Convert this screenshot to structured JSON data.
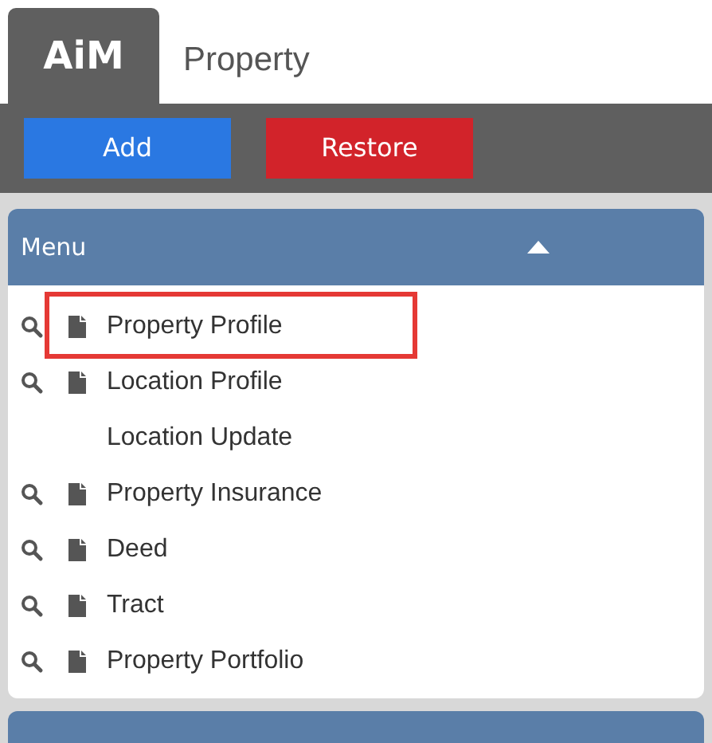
{
  "app_tab": {
    "logo": "AiM",
    "title": "Property"
  },
  "toolbar": [
    {
      "label": "Add",
      "kind": "primary"
    },
    {
      "label": "Restore",
      "kind": "danger"
    }
  ],
  "menu": {
    "title": "Menu",
    "expanded": true,
    "items": [
      {
        "label": "Property Profile",
        "kind": "record",
        "highlighted": true
      },
      {
        "label": "Location Profile",
        "kind": "record",
        "highlighted": false
      },
      {
        "label": "Location Update",
        "kind": "plain",
        "highlighted": false
      },
      {
        "label": "Property Insurance",
        "kind": "record",
        "highlighted": false
      },
      {
        "label": "Deed",
        "kind": "record",
        "highlighted": false
      },
      {
        "label": "Tract",
        "kind": "record",
        "highlighted": false
      },
      {
        "label": "Property Portfolio",
        "kind": "record",
        "highlighted": false
      }
    ]
  }
}
